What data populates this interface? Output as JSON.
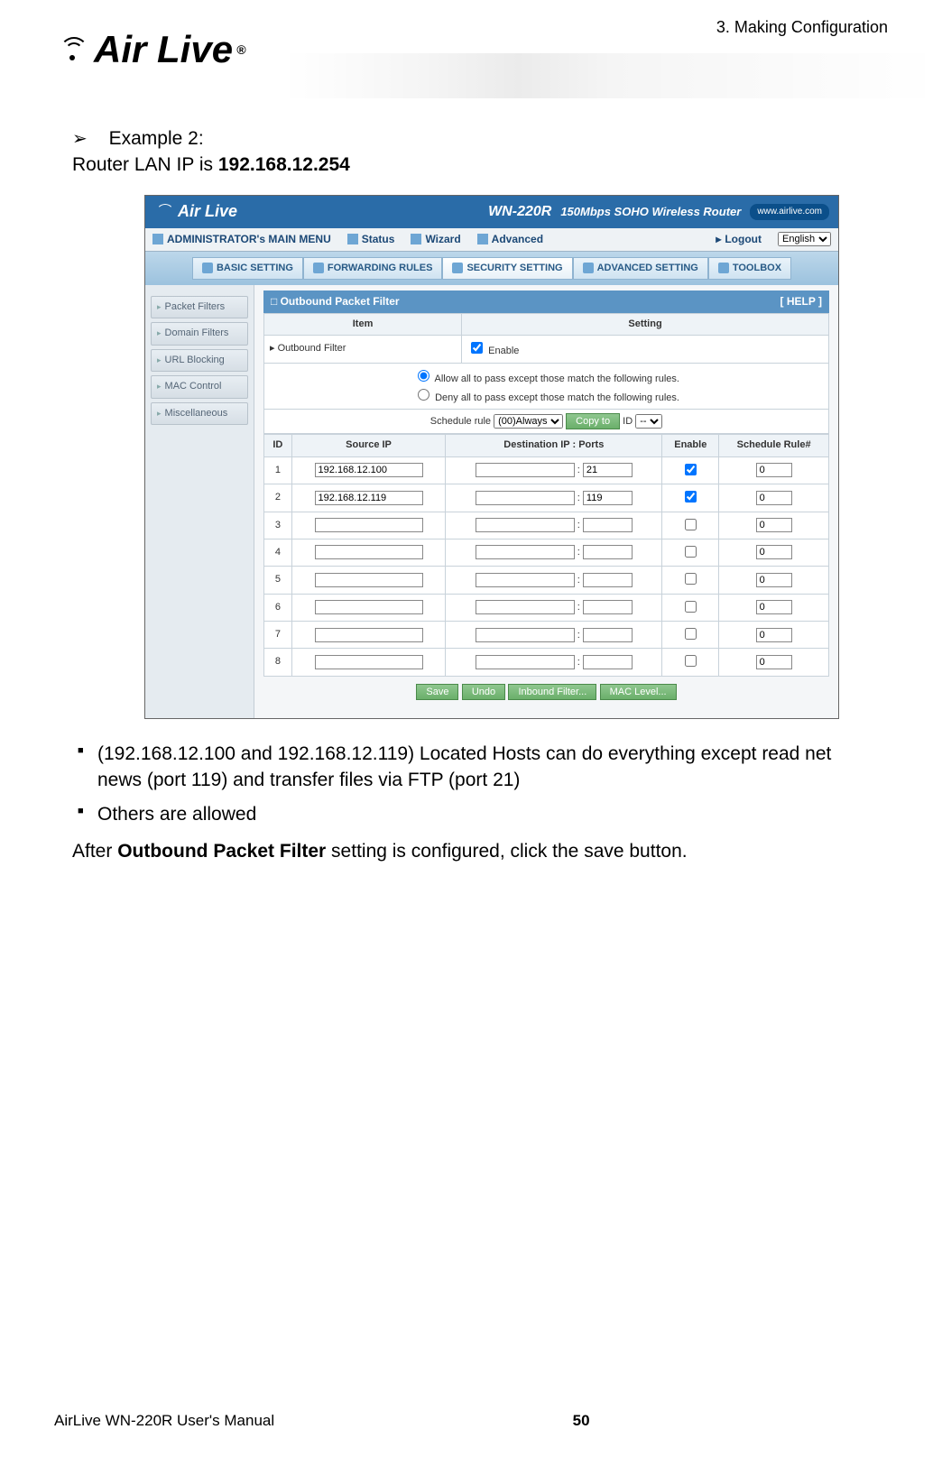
{
  "page": {
    "chapter_header": "3. Making Configuration",
    "logo_text": "Air Live",
    "example_label": "Example 2:",
    "lan_ip_prefix": "Router LAN IP is ",
    "lan_ip_value": "192.168.12.254",
    "bullets": [
      "(192.168.12.100 and 192.168.12.119) Located Hosts can do everything except read net news (port 119) and transfer files via FTP (port 21)",
      "Others are allowed"
    ],
    "after_text_prefix": "After ",
    "after_text_bold": "Outbound Packet Filter",
    "after_text_suffix": " setting is configured, click the save button.",
    "footer_manual": "AirLive WN-220R User's Manual",
    "footer_page": "50"
  },
  "router_ui": {
    "brand": "Air Live",
    "model": "WN-220R",
    "tagline": "150Mbps SOHO Wireless Router",
    "url_pill": "www.airlive.com",
    "menubar": {
      "admin": "ADMINISTRATOR's MAIN MENU",
      "items": [
        "Status",
        "Wizard",
        "Advanced"
      ],
      "logout": "Logout",
      "lang_options": [
        "English"
      ],
      "lang_selected": "English"
    },
    "tabs": [
      "BASIC SETTING",
      "FORWARDING RULES",
      "SECURITY SETTING",
      "ADVANCED SETTING",
      "TOOLBOX"
    ],
    "active_tab": "SECURITY SETTING",
    "sidebar": [
      "Packet Filters",
      "Domain Filters",
      "URL Blocking",
      "MAC Control",
      "Miscellaneous"
    ],
    "panel": {
      "title": "Outbound Packet Filter",
      "help": "[ HELP ]",
      "col_item": "Item",
      "col_setting": "Setting",
      "outbound_filter_label": "Outbound Filter",
      "enable_label": "Enable",
      "enable_checked": true,
      "radio_allow": "Allow all to pass except those match the following rules.",
      "radio_deny": "Deny all to pass except those match the following rules.",
      "radio_selected": "allow",
      "schedule_label": "Schedule rule",
      "schedule_options": [
        "(00)Always"
      ],
      "schedule_selected": "(00)Always",
      "copy_btn": "Copy to",
      "id_label": "ID",
      "id_options": [
        "--"
      ],
      "id_selected": "--",
      "cols": {
        "id": "ID",
        "src": "Source IP",
        "dst": "Destination IP : Ports",
        "enable": "Enable",
        "rule": "Schedule Rule#"
      },
      "rows": [
        {
          "id": "1",
          "src": "192.168.12.100",
          "dst_ip": "",
          "dst_port": "21",
          "enable": true,
          "rule": "0"
        },
        {
          "id": "2",
          "src": "192.168.12.119",
          "dst_ip": "",
          "dst_port": "119",
          "enable": true,
          "rule": "0"
        },
        {
          "id": "3",
          "src": "",
          "dst_ip": "",
          "dst_port": "",
          "enable": false,
          "rule": "0"
        },
        {
          "id": "4",
          "src": "",
          "dst_ip": "",
          "dst_port": "",
          "enable": false,
          "rule": "0"
        },
        {
          "id": "5",
          "src": "",
          "dst_ip": "",
          "dst_port": "",
          "enable": false,
          "rule": "0"
        },
        {
          "id": "6",
          "src": "",
          "dst_ip": "",
          "dst_port": "",
          "enable": false,
          "rule": "0"
        },
        {
          "id": "7",
          "src": "",
          "dst_ip": "",
          "dst_port": "",
          "enable": false,
          "rule": "0"
        },
        {
          "id": "8",
          "src": "",
          "dst_ip": "",
          "dst_port": "",
          "enable": false,
          "rule": "0"
        }
      ],
      "buttons": [
        "Save",
        "Undo",
        "Inbound Filter...",
        "MAC Level..."
      ]
    }
  }
}
